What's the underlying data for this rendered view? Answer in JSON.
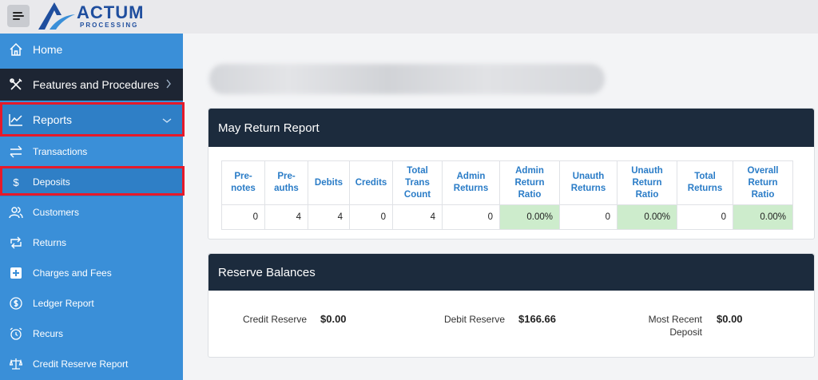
{
  "header": {
    "logo_main": "ACTUM",
    "logo_sub": "PROCESSING"
  },
  "sidebar": {
    "items": [
      {
        "label": "Home",
        "icon": "home-icon"
      },
      {
        "label": "Features and Procedures",
        "icon": "tools-icon"
      },
      {
        "label": "Reports",
        "icon": "chart-line-icon"
      },
      {
        "label": "Transactions",
        "icon": "arrows-exchange-icon"
      },
      {
        "label": "Deposits",
        "icon": "dollar-icon"
      },
      {
        "label": "Customers",
        "icon": "users-icon"
      },
      {
        "label": "Returns",
        "icon": "repeat-icon"
      },
      {
        "label": "Charges and Fees",
        "icon": "plus-square-icon"
      },
      {
        "label": "Ledger Report",
        "icon": "coin-circle-icon"
      },
      {
        "label": "Recurs",
        "icon": "alarm-clock-icon"
      },
      {
        "label": "Credit Reserve Report",
        "icon": "scale-icon"
      }
    ]
  },
  "return_report": {
    "title": "May Return Report",
    "headers": [
      "Pre-\nnotes",
      "Pre-\nauths",
      "Debits",
      "Credits",
      "Total\nTrans\nCount",
      "Admin\nReturns",
      "Admin\nReturn\nRatio",
      "Unauth\nReturns",
      "Unauth\nReturn\nRatio",
      "Total\nReturns",
      "Overall\nReturn\nRatio"
    ],
    "values": [
      "0",
      "4",
      "4",
      "0",
      "4",
      "0",
      "0.00%",
      "0",
      "0.00%",
      "0",
      "0.00%"
    ]
  },
  "reserve_balances": {
    "title": "Reserve Balances",
    "credit_reserve_label": "Credit Reserve",
    "credit_reserve_value": "$0.00",
    "debit_reserve_label": "Debit Reserve",
    "debit_reserve_value": "$166.66",
    "most_recent_deposit_label": "Most Recent\nDeposit",
    "most_recent_deposit_value": "$0.00"
  },
  "colors": {
    "sidebar": "#3a8fd8",
    "sidebar_dark": "#1d2533",
    "card_header": "#1c2b3d",
    "table_header_text": "#2a7cc7",
    "ratio_cell": "#cdeccc",
    "highlight": "#e6192a"
  }
}
